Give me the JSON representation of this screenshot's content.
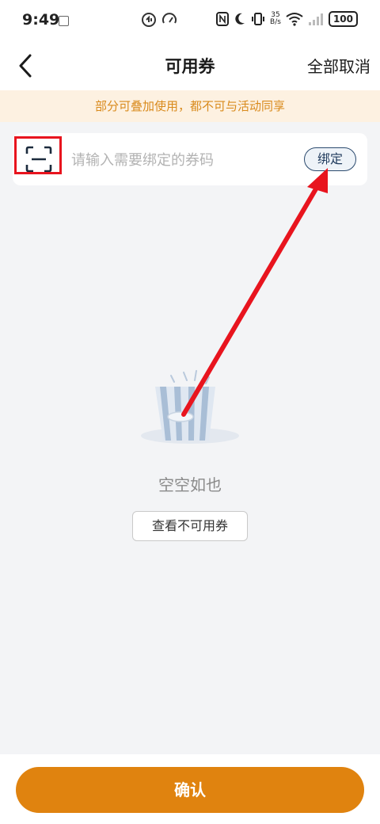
{
  "status_bar": {
    "time": "9:49",
    "net_speed_value": "35",
    "net_speed_unit": "B/s",
    "battery": "100"
  },
  "nav": {
    "title": "可用券",
    "cancel_all": "全部取消"
  },
  "notice": {
    "text": "部分可叠加使用，都不可与活动同享"
  },
  "bind_card": {
    "placeholder": "请输入需要绑定的券码",
    "value": "",
    "bind_label": "绑定"
  },
  "empty_state": {
    "text": "空空如也",
    "view_unavailable_label": "查看不可用券"
  },
  "footer": {
    "confirm_label": "确认"
  },
  "colors": {
    "accent": "#e0830f",
    "notice_text": "#d98a1c",
    "notice_bg": "#fdf1e1",
    "annotation": "#e8141e"
  }
}
